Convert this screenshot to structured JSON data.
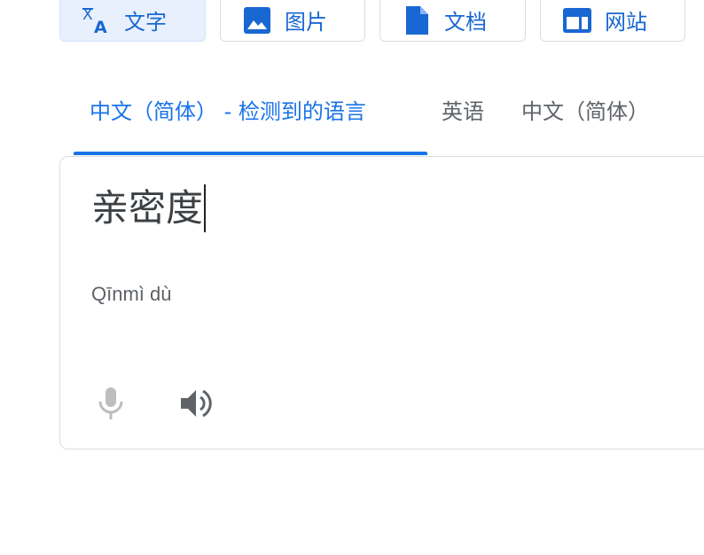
{
  "modes": [
    {
      "label": "文字",
      "icon": "translate-icon"
    },
    {
      "label": "图片",
      "icon": "image-icon"
    },
    {
      "label": "文档",
      "icon": "document-icon"
    },
    {
      "label": "网站",
      "icon": "website-icon"
    }
  ],
  "language_tabs": [
    {
      "label": "中文（简体） - 检测到的语言",
      "selected": true
    },
    {
      "label": "英语",
      "selected": false
    },
    {
      "label": "中文（简体）",
      "selected": false
    }
  ],
  "source": {
    "text": "亲密度",
    "romanization": "Qīnmì dù"
  },
  "colors": {
    "accent": "#1a73e8",
    "active_mode_bg": "#e8f0fe",
    "text_primary": "#3c4043",
    "text_secondary": "#5f6368",
    "border": "#dadce0",
    "mic_disabled": "#bdbdbd"
  }
}
